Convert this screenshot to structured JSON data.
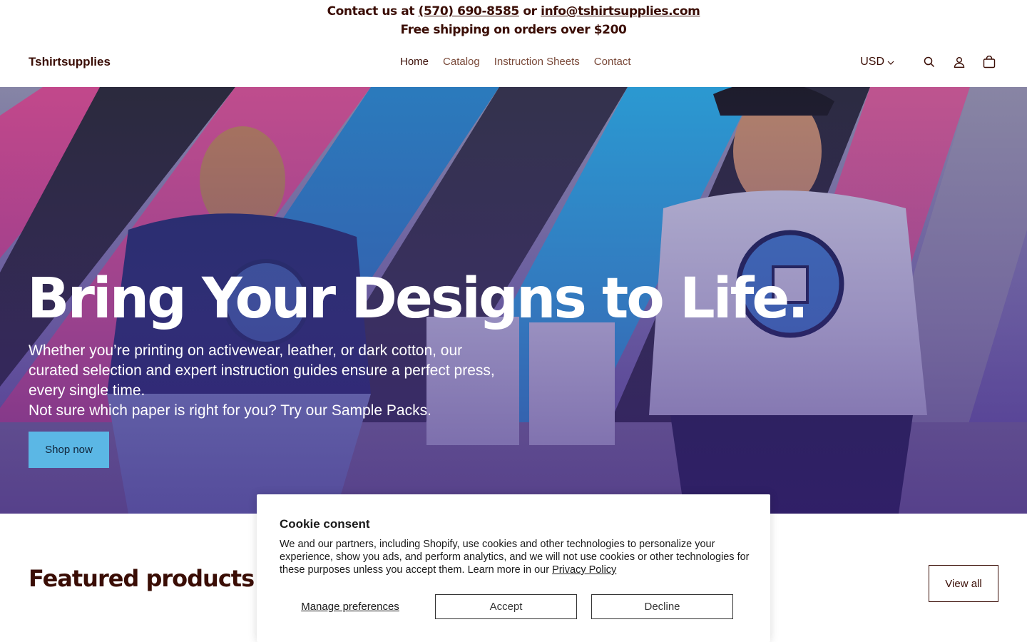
{
  "announcement": {
    "contact_prefix": "Contact us at",
    "phone": "(570) 690-8585",
    "or": "or",
    "email": "info@tshirtsupplies.com",
    "shipping": "Free shipping on orders over $200"
  },
  "header": {
    "logo": "Tshirtsupplies",
    "nav": [
      "Home",
      "Catalog",
      "Instruction Sheets",
      "Contact"
    ],
    "active_nav": "Home",
    "currency": "USD",
    "icons": [
      "search-icon",
      "account-icon",
      "cart-icon"
    ]
  },
  "hero": {
    "title": "Bring Your Designs to Life.",
    "subtitle": "Whether you’re printing on activewear, leather, or dark cotton, our curated selection and expert instruction guides ensure a perfect press, every single time.",
    "subtitle2": "Not sure which paper is right for you? Try our Sample Packs.",
    "cta": "Shop now"
  },
  "featured": {
    "title": "Featured products",
    "view_all": "View all"
  },
  "cookie": {
    "title": "Cookie consent",
    "body": "We and our partners, including Shopify, use cookies and other technologies to personalize your experience, show you ads, and perform analytics, and we will not use cookies or other technologies for these purposes unless you accept them. Learn more in our",
    "privacy_link": "Privacy Policy",
    "manage": "Manage preferences",
    "accept": "Accept",
    "decline": "Decline"
  },
  "colors": {
    "brand_text": "#3a0d05",
    "cta_blue": "#5bb7e5",
    "hero_overlay": "#5b4f9a"
  }
}
